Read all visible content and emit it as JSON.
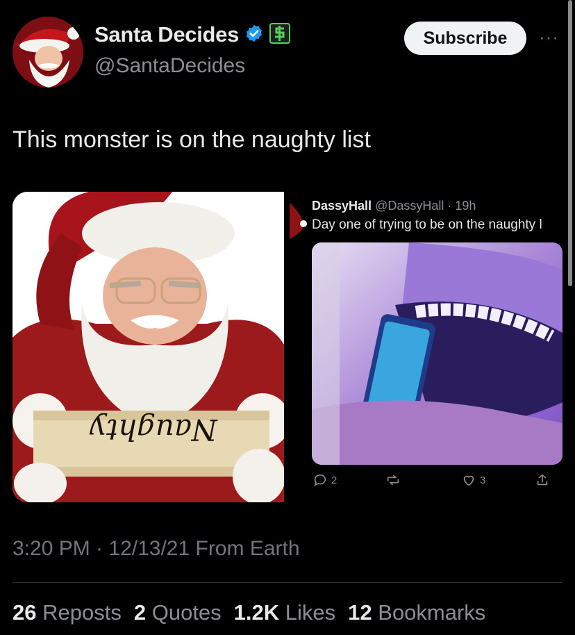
{
  "post": {
    "author_name": "Santa Decides",
    "author_handle": "@SantaDecides",
    "subscribe_label": "Subscribe",
    "more_label": "···",
    "text": "This monster is on the naughty list",
    "timestamp": "3:20 PM · 12/13/21 From Earth"
  },
  "image": {
    "scroll_text": "Naughty"
  },
  "quoted": {
    "name": "DassyHall",
    "meta": "@DassyHall · 19h",
    "text": "Day one of trying to be on the naughty l",
    "replies": "2",
    "likes": "3"
  },
  "stats": [
    {
      "num": "26",
      "label": "Reposts"
    },
    {
      "num": "2",
      "label": "Quotes"
    },
    {
      "num": "1.2K",
      "label": "Likes"
    },
    {
      "num": "12",
      "label": "Bookmarks"
    }
  ],
  "colors": {
    "background": "#000000",
    "verified_badge": "#1d9bf0",
    "secondary_text": "#71767b"
  }
}
